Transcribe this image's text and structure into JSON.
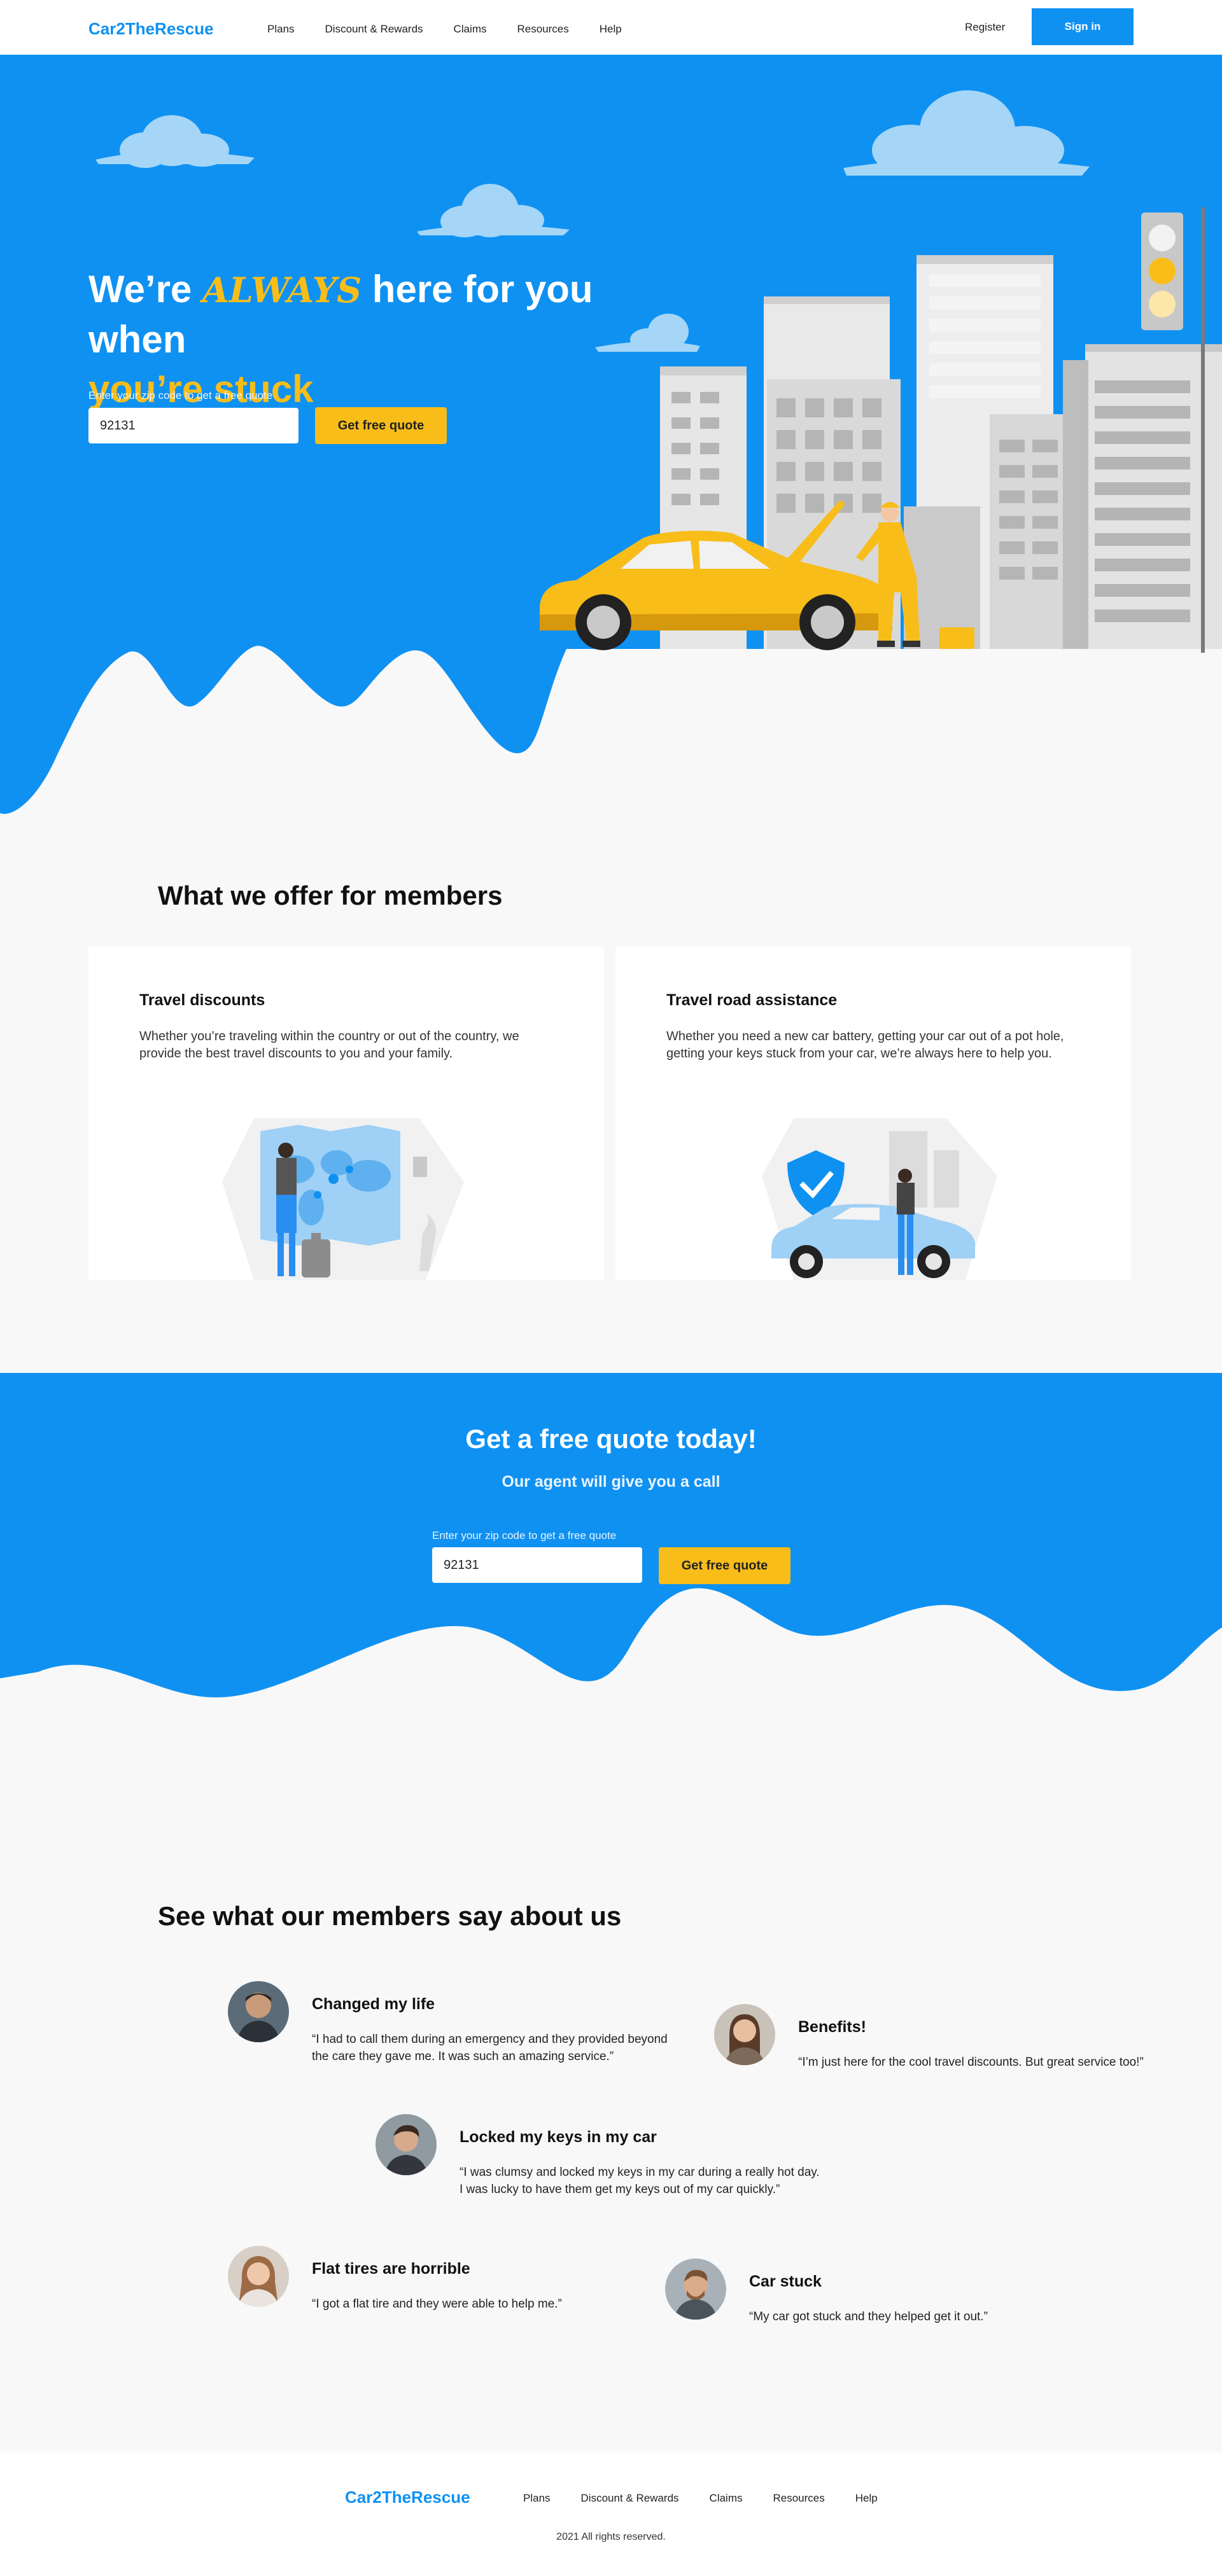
{
  "nav": {
    "logo": "Car2TheRescue",
    "links": [
      "Plans",
      "Discount & Rewards",
      "Claims",
      "Resources",
      "Help"
    ],
    "register": "Register",
    "signin": "Sign in"
  },
  "hero": {
    "title_start": "We’re ",
    "title_emphasis": "ALWAYS",
    "title_middle": " here for you when",
    "title_end": "you’re stuck",
    "zip_label": "Enter your zip code to get a free quote",
    "zip_value": "92131",
    "cta": "Get free quote"
  },
  "offer": {
    "title": "What we offer for members",
    "cards": [
      {
        "title": "Travel discounts",
        "text": "Whether you’re traveling within the country or out of the country, we provide the best travel discounts to you and your family."
      },
      {
        "title": "Travel road assistance",
        "text": "Whether you need a new car battery, getting your car out of a pot hole, getting your keys stuck from your car, we’re always here to help you."
      }
    ]
  },
  "quote_section": {
    "title": "Get a free quote today!",
    "subtitle": "Our agent will give you a call",
    "zip_label": "Enter your zip code to get a free quote",
    "zip_value": "92131",
    "cta": "Get free quote"
  },
  "testimonials": {
    "title": "See what our members say about us",
    "items": [
      {
        "title": "Changed my life",
        "text": "“I had to call them during an emergency and they provided beyond the care they gave me. It was such an amazing service.”"
      },
      {
        "title": "Benefits!",
        "text": "“I’m just here for the cool travel discounts. But great service too!”"
      },
      {
        "title": "Locked my keys in my car",
        "text": "“I was clumsy and locked my keys in my car during a really hot day. I was lucky to have them get my keys out of my car quickly.”"
      },
      {
        "title": "Flat tires are horrible",
        "text": "“I got a flat tire and they were able to help me.”"
      },
      {
        "title": "Car stuck",
        "text": "“My car got stuck and they helped get it out.”"
      }
    ]
  },
  "footer": {
    "logo": "Car2TheRescue",
    "links": [
      "Plans",
      "Discount & Rewards",
      "Claims",
      "Resources",
      "Help"
    ],
    "copyright": "2021 All rights reserved."
  },
  "colors": {
    "brand_blue": "#0f91f2",
    "accent_yellow": "#f8bd19",
    "page_bg": "#f8f8f8",
    "card_bg": "#ffffff"
  }
}
